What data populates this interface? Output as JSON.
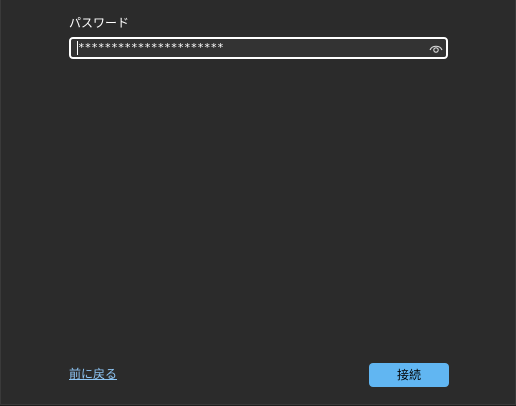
{
  "password": {
    "label": "パスワード",
    "value": "**********************",
    "reveal_icon": "eye-icon"
  },
  "footer": {
    "back_label": "前に戻る",
    "connect_label": "接続"
  },
  "colors": {
    "background": "#2b2b2b",
    "input_border": "#ffffff",
    "link": "#8ec6f5",
    "primary_button": "#61b6f2"
  }
}
